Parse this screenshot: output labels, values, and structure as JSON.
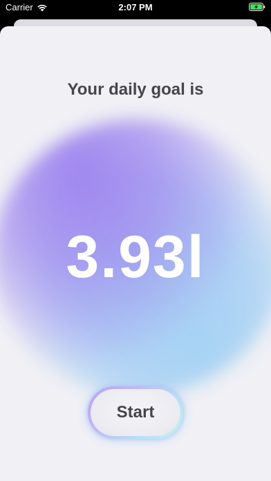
{
  "status_bar": {
    "carrier": "Carrier",
    "time": "2:07 PM",
    "wifi_icon": "wifi-icon",
    "battery_icon": "battery-charging-icon"
  },
  "main": {
    "title": "Your daily goal is",
    "goal_value": "3.93l",
    "start_label": "Start"
  },
  "colors": {
    "sheet_background": "#f0f0f5",
    "text_dark": "#45454b",
    "goal_text": "#ffffff",
    "gradient_purple": "#9f86ee",
    "gradient_blue": "#a6d2f3",
    "battery_green": "#4cd964"
  }
}
